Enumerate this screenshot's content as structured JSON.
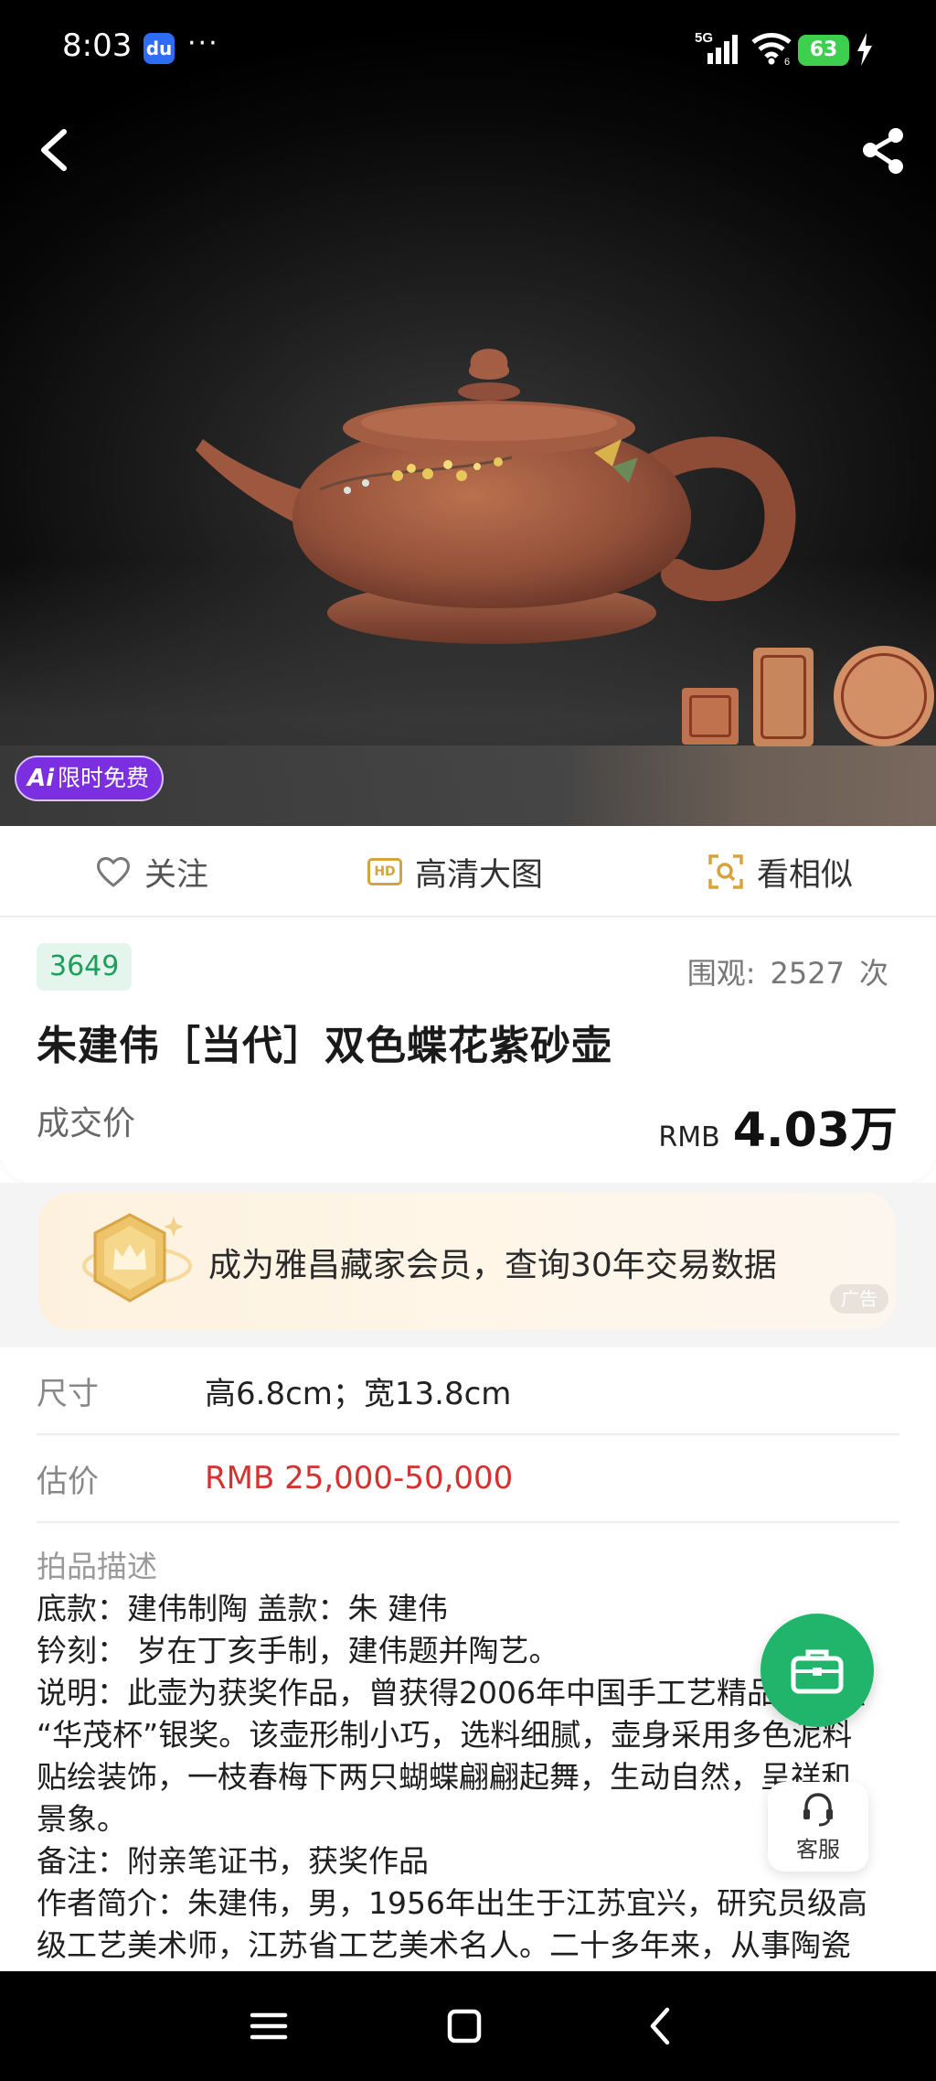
{
  "status_bar": {
    "time": "8:03",
    "dots": "···",
    "network": "5G",
    "wifi_sub": "6",
    "battery": "63"
  },
  "hero": {
    "ai_mark": "Ai",
    "ai_badge": "限时免费"
  },
  "actions": {
    "follow": "关注",
    "hd_icon": "HD",
    "hd": "高清大图",
    "similar": "看相似"
  },
  "lot": {
    "number": "3649",
    "views_label": "围观:",
    "views_count": "2527",
    "views_unit": "次",
    "title": "朱建伟［当代］双色蝶花紫砂壶",
    "deal_label": "成交价",
    "deal_currency": "RMB",
    "deal_value": "4.03万"
  },
  "promo": {
    "text": "成为雅昌藏家会员，查询30年交易数据",
    "ad_tag": "广告"
  },
  "details": {
    "size_label": "尺寸",
    "size_value": "高6.8cm；宽13.8cm",
    "estimate_label": "估价",
    "estimate_value": "RMB  25,000-50,000"
  },
  "description": {
    "title": "拍品描述",
    "lines": [
      "底款：建伟制陶 盖款：朱 建伟",
      "钤刻： 岁在丁亥手制，建伟题并陶艺。",
      "说明：此壶为获奖作品，曾获得2006年中国手工艺精品博览会",
      "“华茂杯”银奖。该壶形制小巧，选料细腻，壶身采用多色泥料",
      "贴绘装饰，一枝春梅下两只蝴蝶翩翩起舞，生动自然，呈祥和",
      "景象。",
      "备注：附亲笔证书，获奖作品",
      "作者简介：朱建伟，男，1956年出生于江苏宜兴，研究员级高",
      "级工艺美术师，江苏省工艺美术名人。二十多年来，从事陶瓷"
    ]
  },
  "floating": {
    "service_label": "客服"
  },
  "colors": {
    "green": "#21b56b",
    "red": "#d4322f",
    "purple": "#7b2fe0",
    "gold": "#d7a33c"
  }
}
